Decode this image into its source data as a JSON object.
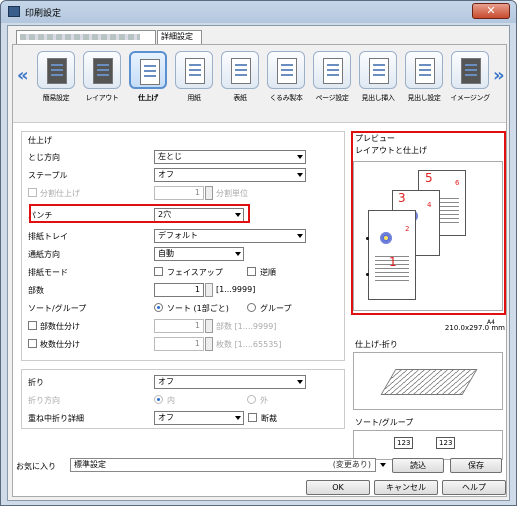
{
  "window": {
    "title": "印刷設定",
    "close_glyph": "✕"
  },
  "tabs": [
    {
      "label": ""
    },
    {
      "label": "詳細設定"
    }
  ],
  "iconbar": {
    "left_arrow": "«",
    "right_arrow": "»",
    "items": [
      {
        "label": "簡易設定",
        "icon": "quick-setting-icon"
      },
      {
        "label": "レイアウト",
        "icon": "layout-icon"
      },
      {
        "label": "仕上げ",
        "icon": "finishing-icon",
        "selected": true
      },
      {
        "label": "用紙",
        "icon": "paper-icon"
      },
      {
        "label": "表紙",
        "icon": "cover-icon"
      },
      {
        "label": "くるみ製本",
        "icon": "perfect-binding-icon"
      },
      {
        "label": "ページ設定",
        "icon": "page-setting-icon"
      },
      {
        "label": "見出し挿入",
        "icon": "tab-insert-icon"
      },
      {
        "label": "見出し設定",
        "icon": "tab-setting-icon"
      },
      {
        "label": "イメージング",
        "icon": "imaging-icon"
      }
    ]
  },
  "finishing": {
    "group_title": "仕上げ",
    "binding_label": "とじ方向",
    "binding_value": "左とじ",
    "staple_label": "ステープル",
    "staple_value": "オフ",
    "split_label": "分割仕上げ",
    "split_value": "1",
    "split_unit": "分割単位",
    "punch_label": "パンチ",
    "punch_value": "2穴",
    "tray_label": "排紙トレイ",
    "tray_value": "デフォルト",
    "feed_label": "通紙方向",
    "feed_value": "自動",
    "output_label": "排紙モード",
    "faceup_label": "フェイスアップ",
    "reverse_label": "逆順",
    "copies_label": "部数",
    "copies_value": "1",
    "copies_range": "[1...9999]",
    "sort_label": "ソート/グループ",
    "sort_option": "ソート (1部ごと)",
    "group_option": "グループ",
    "offset_label": "部数仕分け",
    "offset_value": "1",
    "offset_unit": "部数 [1....9999]",
    "sheet_label": "枚数仕分け",
    "sheet_value": "1",
    "sheet_unit": "枚数 [1....65535]",
    "fold_label": "折り",
    "fold_value": "オフ",
    "folddir_label": "折り方向",
    "fold_in": "内",
    "fold_out": "外",
    "multifold_label": "重ね中折り詳細",
    "multifold_value": "オフ",
    "cut_label": "断裁"
  },
  "preview": {
    "title": "プレビュー",
    "subtitle": "レイアウトと仕上げ",
    "paper_code": "A4",
    "paper_size": "210.0x297.0 mm",
    "page_numbers": [
      "1",
      "2",
      "3",
      "4",
      "5",
      "6"
    ],
    "fold_title": "仕上げ-折り",
    "sort_title": "ソート/グループ",
    "sort_icon_digits": [
      "1",
      "2",
      "3"
    ]
  },
  "bottom": {
    "favorite_label": "お気に入り",
    "favorite_value": "標準設定",
    "changed": "(変更あり)",
    "load_label": "読込",
    "save_label": "保存",
    "ok_label": "OK",
    "cancel_label": "キャンセル",
    "help_label": "ヘルプ"
  },
  "colors": {
    "highlight": "#e01010",
    "accent": "#3c78c8"
  }
}
